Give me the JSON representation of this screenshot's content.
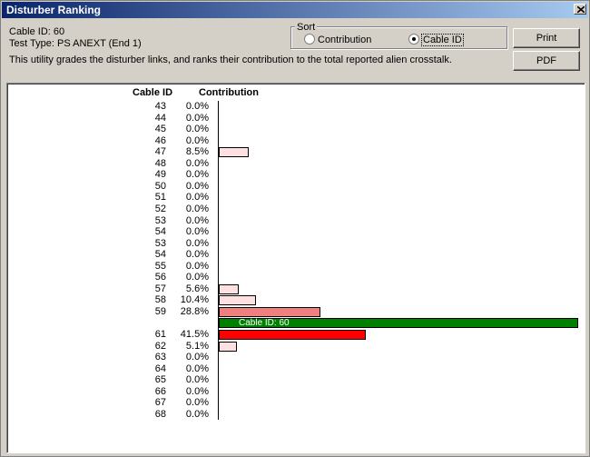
{
  "window": {
    "title": "Disturber Ranking"
  },
  "info": {
    "cable_id": "Cable ID: 60",
    "test_type": "Test Type: PS ANEXT (End 1)",
    "description": "This utility grades the disturber links, and ranks their contribution to the total reported alien crosstalk."
  },
  "sort": {
    "legend": "Sort",
    "option_contribution": "Contribution",
    "option_cable_id": "Cable ID",
    "selected": "Cable ID"
  },
  "buttons": {
    "print": "Print",
    "pdf": "PDF"
  },
  "colors": {
    "selected_bar": "#008000",
    "max_bar": "#ff0000",
    "high_bar": "#f08080",
    "low_bar": "#ffe0e0"
  },
  "chart_data": {
    "type": "bar",
    "headers": {
      "id": "Cable ID",
      "value": "Contribution"
    },
    "rows": [
      {
        "id": "43",
        "label": "0.0%",
        "value": 0.0
      },
      {
        "id": "44",
        "label": "0.0%",
        "value": 0.0
      },
      {
        "id": "45",
        "label": "0.0%",
        "value": 0.0
      },
      {
        "id": "46",
        "label": "0.0%",
        "value": 0.0
      },
      {
        "id": "47",
        "label": "8.5%",
        "value": 8.5
      },
      {
        "id": "48",
        "label": "0.0%",
        "value": 0.0
      },
      {
        "id": "49",
        "label": "0.0%",
        "value": 0.0
      },
      {
        "id": "50",
        "label": "0.0%",
        "value": 0.0
      },
      {
        "id": "51",
        "label": "0.0%",
        "value": 0.0
      },
      {
        "id": "52",
        "label": "0.0%",
        "value": 0.0
      },
      {
        "id": "53",
        "label": "0.0%",
        "value": 0.0
      },
      {
        "id": "54",
        "label": "0.0%",
        "value": 0.0
      },
      {
        "id": "53",
        "label": "0.0%",
        "value": 0.0
      },
      {
        "id": "54",
        "label": "0.0%",
        "value": 0.0
      },
      {
        "id": "55",
        "label": "0.0%",
        "value": 0.0
      },
      {
        "id": "56",
        "label": "0.0%",
        "value": 0.0
      },
      {
        "id": "57",
        "label": "5.6%",
        "value": 5.6
      },
      {
        "id": "58",
        "label": "10.4%",
        "value": 10.4
      },
      {
        "id": "59",
        "label": "28.8%",
        "value": 28.8
      },
      {
        "id": "",
        "label": "",
        "value": null,
        "selected": true,
        "selected_label": "Cable ID: 60"
      },
      {
        "id": "61",
        "label": "41.5%",
        "value": 41.5
      },
      {
        "id": "62",
        "label": "5.1%",
        "value": 5.1
      },
      {
        "id": "63",
        "label": "0.0%",
        "value": 0.0
      },
      {
        "id": "64",
        "label": "0.0%",
        "value": 0.0
      },
      {
        "id": "65",
        "label": "0.0%",
        "value": 0.0
      },
      {
        "id": "66",
        "label": "0.0%",
        "value": 0.0
      },
      {
        "id": "67",
        "label": "0.0%",
        "value": 0.0
      },
      {
        "id": "68",
        "label": "0.0%",
        "value": 0.0
      }
    ]
  }
}
